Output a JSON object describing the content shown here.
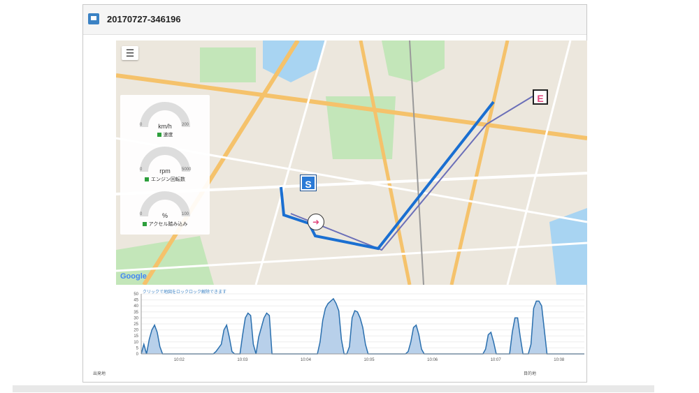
{
  "window": {
    "title": "20170727-346196"
  },
  "map": {
    "menu_icon": "hamburger-icon",
    "start_marker": "S",
    "end_marker": "E",
    "attribution": "Google"
  },
  "gauges": [
    {
      "unit": "km/h",
      "min": "0",
      "max": "200",
      "legend": "速度",
      "value": 0
    },
    {
      "unit": "rpm",
      "min": "0",
      "max": "5000",
      "legend": "エンジン回転数",
      "value": 0
    },
    {
      "unit": "%",
      "min": "0",
      "max": "100",
      "legend": "アクセル踏み込み",
      "value": 0
    }
  ],
  "chart_data": {
    "type": "area",
    "caption": "クリックで地図をロックロック解除できます",
    "ylim": [
      0,
      50
    ],
    "yticks": [
      "50",
      "45",
      "40",
      "35",
      "30",
      "25",
      "20",
      "15",
      "10",
      "5",
      "0"
    ],
    "xticks": [
      "10:02",
      "10:03",
      "10:04",
      "10:05",
      "10:06",
      "10:07",
      "10:08"
    ],
    "x": [
      0,
      0.05,
      0.1,
      0.15,
      0.2,
      0.25,
      0.3,
      0.35,
      0.4,
      0.45,
      0.5,
      0.55,
      0.6,
      0.65,
      0.7,
      0.75,
      0.8,
      0.85,
      0.9,
      0.95,
      1.0,
      1.05,
      1.1,
      1.15,
      1.2,
      1.25,
      1.3,
      1.35,
      1.4,
      1.45,
      1.5,
      1.55,
      1.6,
      1.65,
      1.7,
      1.75,
      1.8,
      1.85,
      1.9,
      1.95,
      2.0,
      2.05,
      2.1,
      2.15,
      2.2,
      2.25,
      2.3,
      2.35,
      2.4,
      2.45,
      2.5,
      2.55,
      2.6,
      2.65,
      2.7,
      2.75,
      2.8,
      2.85,
      2.9,
      2.95,
      3.0,
      3.05,
      3.1,
      3.15,
      3.2,
      3.25,
      3.3,
      3.35,
      3.4,
      3.45,
      3.5,
      3.55,
      3.6,
      3.65,
      3.7,
      3.75,
      3.8,
      3.85,
      3.9,
      3.95,
      4.0,
      4.05,
      4.1,
      4.15,
      4.2,
      4.25,
      4.3,
      4.35,
      4.4,
      4.45,
      4.5,
      4.55,
      4.6,
      4.65,
      4.7,
      4.75,
      4.8,
      4.85,
      4.9,
      4.95,
      5.0,
      5.05,
      5.1,
      5.15,
      5.2,
      5.25,
      5.3,
      5.35,
      5.4,
      5.45,
      5.5,
      5.55,
      5.6,
      5.65,
      5.7,
      5.75,
      5.8,
      5.85,
      5.9,
      5.95,
      6.0,
      6.05,
      6.1,
      6.15,
      6.2,
      6.25,
      6.3,
      6.35,
      6.4,
      6.45,
      6.5,
      6.55,
      6.6,
      6.65,
      6.7,
      6.75,
      6.8,
      6.85,
      6.9,
      6.95,
      7.0,
      7.05,
      7.1,
      7.15,
      7.2,
      7.25,
      7.3,
      7.35,
      7.4,
      7.45,
      7.5,
      7.55,
      7.6,
      7.65,
      7.7,
      7.75,
      7.8,
      7.85,
      7.9,
      7.95,
      8.0,
      8.05,
      8.1,
      8.15,
      8.2,
      8.25,
      8.3
    ],
    "series": [
      {
        "values": [
          0,
          8,
          0,
          12,
          20,
          24,
          18,
          6,
          0,
          0,
          0,
          0,
          0,
          0,
          0,
          0,
          0,
          0,
          0,
          0,
          0,
          0,
          0,
          0,
          0,
          0,
          0,
          0,
          2,
          5,
          8,
          20,
          24,
          14,
          2,
          0,
          0,
          0,
          16,
          30,
          34,
          32,
          8,
          0,
          14,
          22,
          30,
          34,
          32,
          0,
          0,
          0,
          0,
          0,
          0,
          0,
          0,
          0,
          0,
          0,
          0,
          0,
          0,
          0,
          0,
          0,
          0,
          10,
          28,
          38,
          42,
          44,
          46,
          42,
          36,
          12,
          0,
          0,
          6,
          30,
          36,
          35,
          30,
          22,
          8,
          0,
          0,
          0,
          0,
          0,
          0,
          0,
          0,
          0,
          0,
          0,
          0,
          0,
          0,
          0,
          2,
          10,
          22,
          24,
          16,
          4,
          0,
          0,
          0,
          0,
          0,
          0,
          0,
          0,
          0,
          0,
          0,
          0,
          0,
          0,
          0,
          0,
          0,
          0,
          0,
          0,
          0,
          0,
          0,
          4,
          16,
          18,
          10,
          0,
          0,
          0,
          0,
          0,
          0,
          18,
          30,
          30,
          14,
          0,
          0,
          0,
          8,
          38,
          44,
          44,
          40,
          20,
          0,
          0,
          0,
          0,
          0,
          0,
          0,
          0,
          0,
          0,
          0,
          0,
          0,
          0,
          0,
          0,
          0,
          0,
          0,
          0,
          0,
          0,
          0
        ]
      }
    ]
  },
  "footer": {
    "left": "出発地",
    "right": "目的地"
  },
  "colors": {
    "route": "#1a6fd1",
    "area_fill": "#b8d0ea",
    "line": "#2a6fae",
    "gauge_legend": "#2d9f3c"
  }
}
